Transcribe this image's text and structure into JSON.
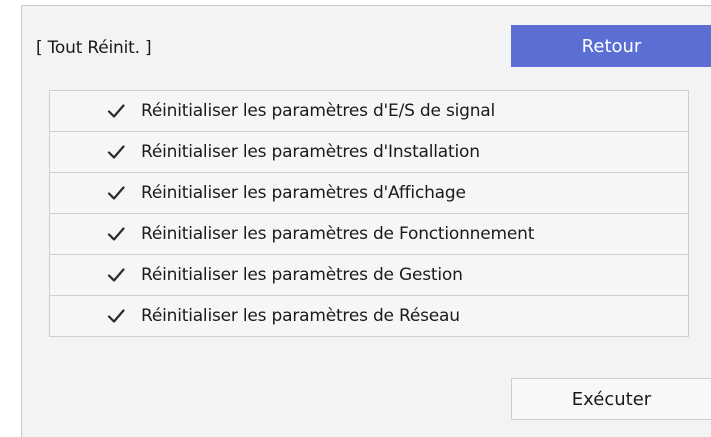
{
  "dialog": {
    "title": "[ Tout Réinit. ]",
    "back_label": "Retour",
    "execute_label": "Exécuter"
  },
  "reset_items": [
    {
      "label": "Réinitialiser les paramètres d'E/S de signal",
      "checked": true,
      "icon": "check-icon"
    },
    {
      "label": "Réinitialiser les paramètres d'Installation",
      "checked": true,
      "icon": "check-icon"
    },
    {
      "label": "Réinitialiser les paramètres d'Affichage",
      "checked": true,
      "icon": "check-icon"
    },
    {
      "label": "Réinitialiser les paramètres de Fonctionnement",
      "checked": true,
      "icon": "check-icon"
    },
    {
      "label": "Réinitialiser les paramètres de Gestion",
      "checked": true,
      "icon": "check-icon"
    },
    {
      "label": "Réinitialiser les paramètres de Réseau",
      "checked": true,
      "icon": "check-icon"
    }
  ],
  "colors": {
    "accent": "#5b6ed3",
    "panel_background": "#f3f3f3",
    "border": "#cfcfcf",
    "text": "#1a1a1a"
  }
}
